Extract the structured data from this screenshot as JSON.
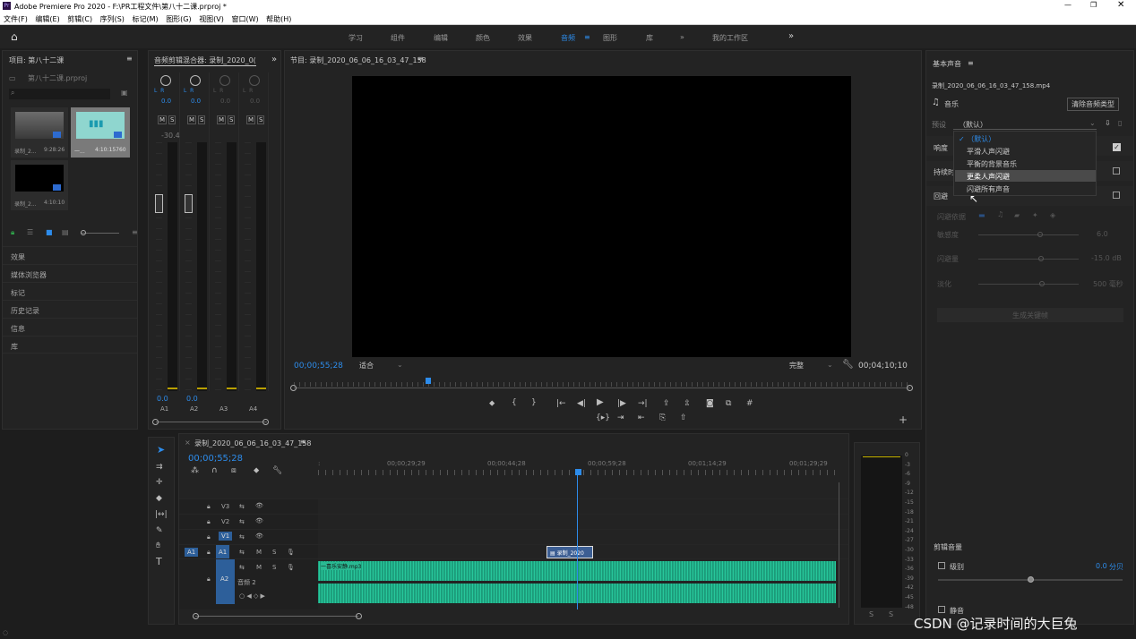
{
  "window": {
    "title": "Adobe Premiere Pro 2020 - F:\\PR工程文件\\第八十二课.prproj *"
  },
  "menu": [
    "文件(F)",
    "编辑(E)",
    "剪辑(C)",
    "序列(S)",
    "标记(M)",
    "图形(G)",
    "视图(V)",
    "窗口(W)",
    "帮助(H)"
  ],
  "workspaces": [
    "学习",
    "组件",
    "编辑",
    "颜色",
    "效果",
    "音频",
    "图形",
    "库",
    "»",
    "我的工作区"
  ],
  "active_workspace": "音频",
  "project": {
    "title": "项目: 第八十二课",
    "file": "第八十二课.prproj",
    "items": [
      {
        "name": "录制_2...",
        "dur": "9:28:26"
      },
      {
        "name": "一...",
        "dur": "4:10:15760"
      },
      {
        "name": "录制_2...",
        "dur": "4:10:10"
      }
    ],
    "panels": [
      "效果",
      "媒体浏览器",
      "标记",
      "历史记录",
      "信息",
      "库"
    ]
  },
  "mixer": {
    "title": "音频剪辑混合器: 录制_2020_0(",
    "values": [
      "0.0",
      "0.0",
      "0.0",
      "0.0"
    ],
    "peak": "-30.4",
    "bottom": [
      "0.0",
      "0.0"
    ],
    "tracks": [
      "A1",
      "A2",
      "A3",
      "A4"
    ]
  },
  "program": {
    "title": "节目: 录制_2020_06_06_16_03_47_158",
    "timecode": "00;00;55;28",
    "fit": "适合",
    "quality": "完整",
    "duration": "00;04;10;10"
  },
  "timeline": {
    "title": "录制_2020_06_06_16_03_47_158",
    "timecode": "00;00;55;28",
    "ruler": [
      "00;00;29;29",
      "00;00;44;28",
      "00;00;59;28",
      "00;01;14;29",
      "00;01;29;29"
    ],
    "tracks": [
      "V3",
      "V2",
      "V1",
      "A1",
      "A2"
    ],
    "audio_label": "音频 2",
    "clip_a1": "一喜乐安静.mp3",
    "clip_v": "录制_2020",
    "meter_scale": [
      "0",
      "-3",
      "-6",
      "-9",
      "-12",
      "-15",
      "-18",
      "-21",
      "-24",
      "-27",
      "-30",
      "-33",
      "-36",
      "-39",
      "-42",
      "-45",
      "-48"
    ]
  },
  "essential": {
    "title": "基本声音",
    "clip": "录制_2020_06_06_16_03_47_158.mp4",
    "type": "音乐",
    "clear": "清除音频类型",
    "preset_label": "预设",
    "preset_value": "（默认）",
    "dropdown": [
      "（默认）",
      "平滑人声闪避",
      "平衡的背景音乐",
      "更柔人声闪避",
      "闪避所有声音"
    ],
    "sections": [
      "响度",
      "持续时",
      "回避"
    ],
    "duck_rows": [
      {
        "label": "闪避依据"
      },
      {
        "label": "敏感度",
        "value": "6.0"
      },
      {
        "label": "闪避量",
        "value": "-15.0 dB"
      },
      {
        "label": "淡化",
        "value": "500 毫秒"
      }
    ],
    "generate": "生成关键帧",
    "clip_volume": "剪辑音量",
    "level": "级别",
    "level_value": "0.0",
    "level_unit": "分贝",
    "mute": "静音",
    "watermark": "CSDN @记录时间的大巨兔"
  }
}
